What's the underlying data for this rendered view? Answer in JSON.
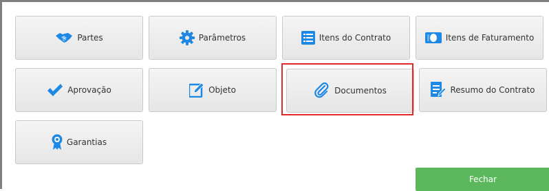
{
  "tiles": [
    {
      "label": "Partes",
      "icon": "handshake-icon"
    },
    {
      "label": "Parâmetros",
      "icon": "gear-icon"
    },
    {
      "label": "Itens do Contrato",
      "icon": "list-icon"
    },
    {
      "label": "Itens de Faturamento",
      "icon": "billing-icon"
    },
    {
      "label": "Aprovação",
      "icon": "checkmark-icon"
    },
    {
      "label": "Objeto",
      "icon": "edit-icon"
    },
    {
      "label": "Documentos",
      "icon": "paperclip-icon"
    },
    {
      "label": "Resumo do Contrato",
      "icon": "document-edit-icon"
    },
    {
      "label": "Garantias",
      "icon": "award-ribbon-icon"
    }
  ],
  "selected_tile": "Documentos",
  "close_button": {
    "label": "Fechar"
  },
  "colors": {
    "icon_blue": "#1e88e5",
    "highlight_red": "#e0282b",
    "close_green": "#5cb85c"
  }
}
